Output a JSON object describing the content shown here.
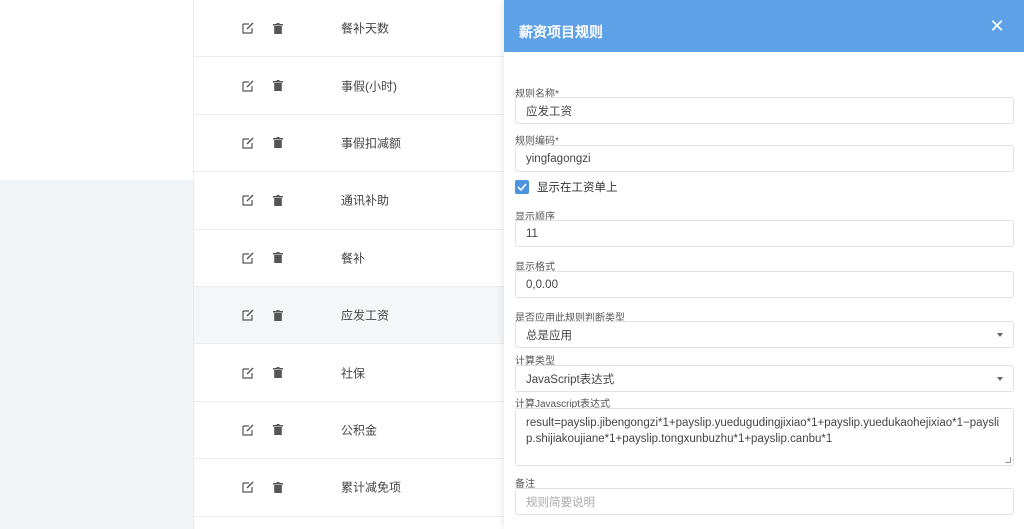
{
  "list": {
    "rows": [
      {
        "name": "餐补天数"
      },
      {
        "name": "事假(小时)"
      },
      {
        "name": "事假扣减额"
      },
      {
        "name": "通讯补助"
      },
      {
        "name": "餐补"
      },
      {
        "name": "应发工资"
      },
      {
        "name": "社保"
      },
      {
        "name": "公积金"
      },
      {
        "name": "累计减免项"
      }
    ]
  },
  "panel": {
    "title": "薪资项目规则",
    "close_icon": "close-icon",
    "rule_name_label": "规则名称*",
    "rule_name_value": "应发工资",
    "rule_code_label": "规则编码*",
    "rule_code_value": "yingfagongzi",
    "show_on_payslip_label": "显示在工资单上",
    "show_on_payslip_checked": true,
    "display_order_label": "显示顺序",
    "display_order_value": "11",
    "display_format_label": "显示格式",
    "display_format_value": "0,0.00",
    "apply_rule_type_label": "是否应用此规则判断类型",
    "apply_rule_type_value": "总是应用",
    "calc_type_label": "计算类型",
    "calc_type_value": "JavaScript表达式",
    "calc_js_label": "计算Javascript表达式",
    "calc_js_value": "result=payslip.jibengongzi*1+payslip.yuedugudingjixiao*1+payslip.yuedukaohejixiao*1−payslip.shijiakoujiane*1+payslip.tongxunbuzhu*1+payslip.canbu*1",
    "remarks_label": "备注",
    "remarks_placeholder": "规则简要说明"
  },
  "colors": {
    "header": "#5fa1e6",
    "checkbox": "#4c93e0",
    "left_bg": "#f1f4f6"
  }
}
